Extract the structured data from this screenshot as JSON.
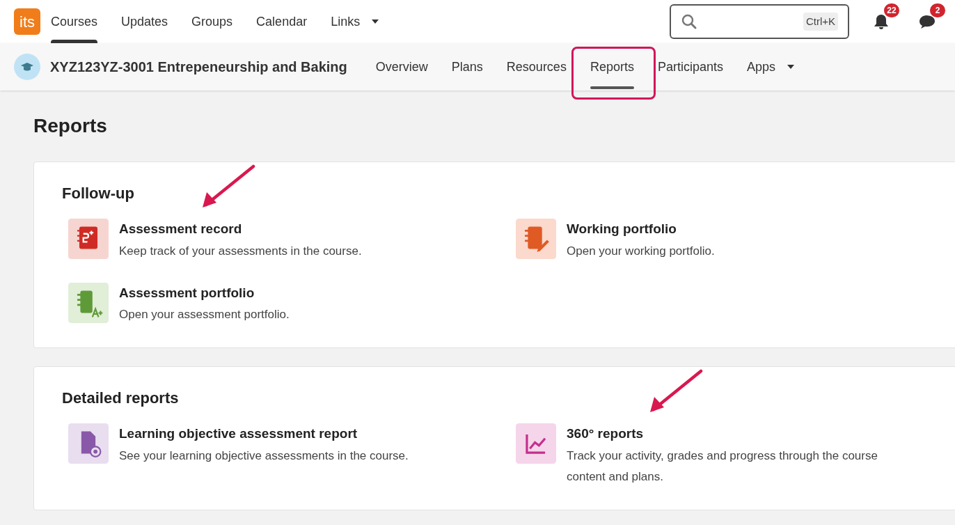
{
  "top_nav": {
    "logo": "its",
    "items": [
      {
        "label": "Courses",
        "selected": true
      },
      {
        "label": "Updates",
        "selected": false
      },
      {
        "label": "Groups",
        "selected": false
      },
      {
        "label": "Calendar",
        "selected": false
      },
      {
        "label": "Links",
        "selected": false,
        "dropdown": true
      }
    ],
    "search": {
      "shortcut": "Ctrl+K"
    },
    "notifications": "22",
    "messages": "2"
  },
  "course_bar": {
    "title": "XYZ123YZ-3001 Entrepeneurship and Baking",
    "tabs": [
      {
        "label": "Overview",
        "selected": false,
        "annotated": false
      },
      {
        "label": "Plans",
        "selected": false,
        "annotated": false
      },
      {
        "label": "Resources",
        "selected": false,
        "annotated": false
      },
      {
        "label": "Reports",
        "selected": true,
        "annotated": true
      },
      {
        "label": "Participants",
        "selected": false,
        "annotated": false
      },
      {
        "label": "Apps",
        "selected": false,
        "annotated": false,
        "dropdown": true
      }
    ]
  },
  "page_title": "Reports",
  "sections": [
    {
      "title": "Follow-up",
      "items": [
        {
          "kind": "record",
          "title": "Assessment record",
          "description": "Keep track of your assessments in the course.",
          "arrow": true
        },
        {
          "kind": "working-portfolio",
          "title": "Working portfolio",
          "description": "Open your working portfolio.",
          "arrow": false
        },
        {
          "kind": "assessment-portfolio",
          "title": "Assessment portfolio",
          "description": "Open your assessment portfolio.",
          "arrow": false
        }
      ]
    },
    {
      "title": "Detailed reports",
      "items": [
        {
          "kind": "objective-report",
          "title": "Learning objective assessment report",
          "description": "See your learning objective assessments in the course.",
          "arrow": false
        },
        {
          "kind": "chart",
          "title": "360° reports",
          "description": "Track your activity, grades and progress through the course content and plans.",
          "arrow": true
        }
      ]
    }
  ]
}
